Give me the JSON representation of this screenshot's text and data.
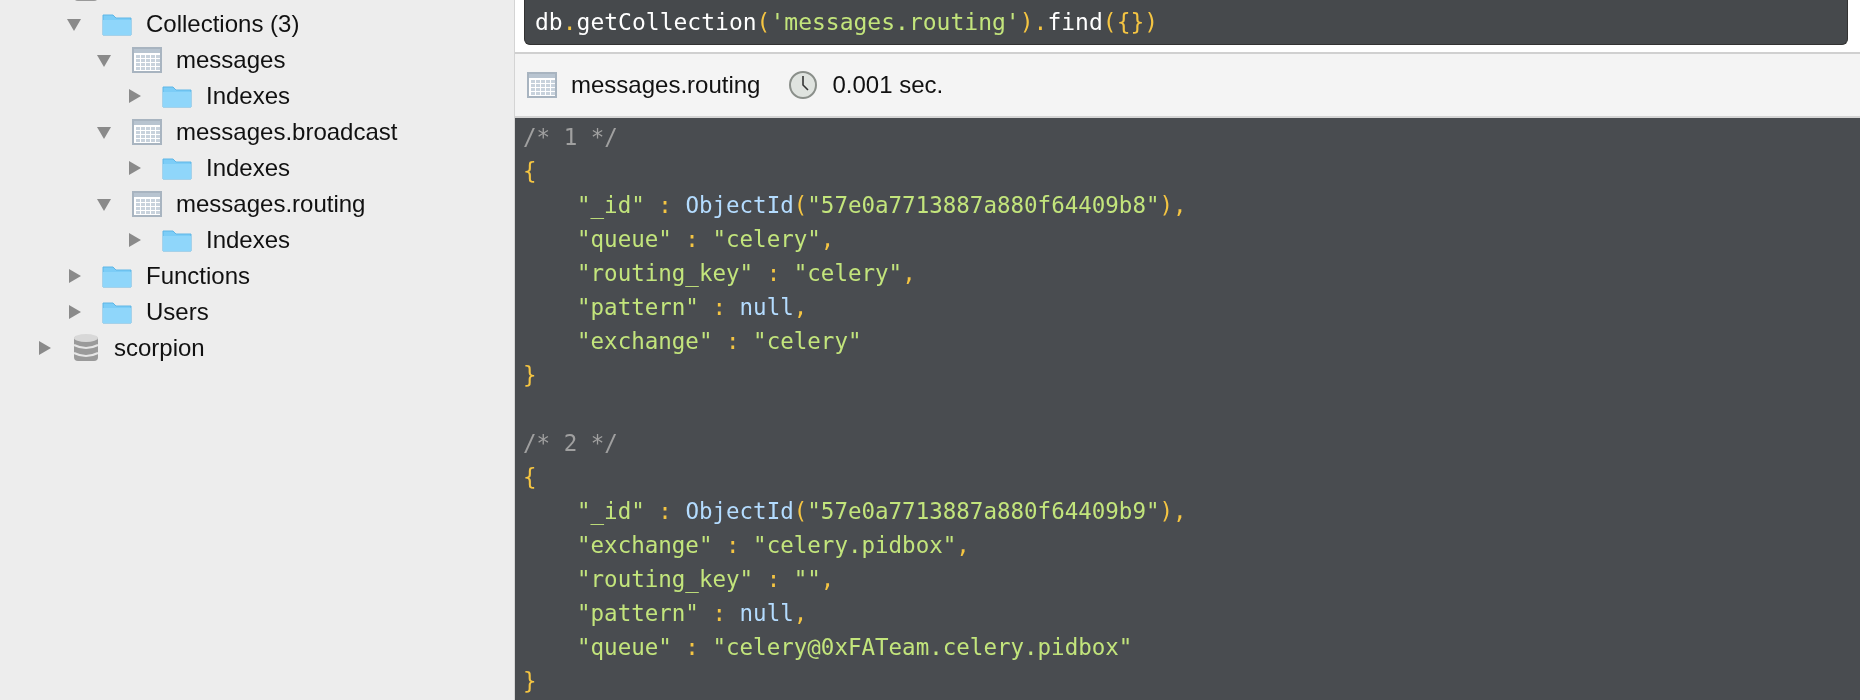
{
  "sidebar": {
    "tree": [
      {
        "kind": "database",
        "children": [
          {
            "kind": "folder",
            "label": "Collections (3)",
            "expanded": true,
            "children": [
              {
                "kind": "table",
                "label": "messages",
                "expanded": true,
                "children": [
                  {
                    "kind": "folder",
                    "label": "Indexes",
                    "expanded": false
                  }
                ]
              },
              {
                "kind": "table",
                "label": "messages.broadcast",
                "expanded": true,
                "children": [
                  {
                    "kind": "folder",
                    "label": "Indexes",
                    "expanded": false
                  }
                ]
              },
              {
                "kind": "table",
                "label": "messages.routing",
                "expanded": true,
                "children": [
                  {
                    "kind": "folder",
                    "label": "Indexes",
                    "expanded": false
                  }
                ]
              }
            ]
          },
          {
            "kind": "folder",
            "label": "Functions",
            "expanded": false
          },
          {
            "kind": "folder",
            "label": "Users",
            "expanded": false
          }
        ]
      },
      {
        "kind": "database",
        "label": "scorpion",
        "expanded": false
      }
    ]
  },
  "query": {
    "calls": [
      {
        "name": "db",
        "after": "."
      },
      {
        "name": "getCollection",
        "open": "(",
        "argument": "'messages.routing'",
        "after": ")."
      },
      {
        "name": "find",
        "after": "({})"
      }
    ]
  },
  "result_header": {
    "collection": "messages.routing",
    "time": "0.001 sec."
  },
  "results": {
    "documents": [
      {
        "comment": "/* 1 */",
        "open": "{",
        "close": "}",
        "fields": [
          [
            {
              "kind": "string",
              "text": "\"_id\""
            },
            {
              "kind": "punct",
              "text": " : "
            },
            {
              "kind": "func",
              "text": "ObjectId"
            },
            {
              "kind": "punct",
              "text": "("
            },
            {
              "kind": "string",
              "text": "\"57e0a7713887a880f64409b8\""
            },
            {
              "kind": "punct",
              "text": "),"
            }
          ],
          [
            {
              "kind": "string",
              "text": "\"queue\""
            },
            {
              "kind": "punct",
              "text": " : "
            },
            {
              "kind": "string",
              "text": "\"celery\""
            },
            {
              "kind": "punct",
              "text": ","
            }
          ],
          [
            {
              "kind": "string",
              "text": "\"routing_key\""
            },
            {
              "kind": "punct",
              "text": " : "
            },
            {
              "kind": "string",
              "text": "\"celery\""
            },
            {
              "kind": "punct",
              "text": ","
            }
          ],
          [
            {
              "kind": "string",
              "text": "\"pattern\""
            },
            {
              "kind": "punct",
              "text": " : "
            },
            {
              "kind": "func",
              "text": "null"
            },
            {
              "kind": "punct",
              "text": ","
            }
          ],
          [
            {
              "kind": "string",
              "text": "\"exchange\""
            },
            {
              "kind": "punct",
              "text": " : "
            },
            {
              "kind": "string",
              "text": "\"celery\""
            }
          ]
        ]
      },
      {
        "comment": "/* 2 */",
        "open": "{",
        "close": "}",
        "fields": [
          [
            {
              "kind": "string",
              "text": "\"_id\""
            },
            {
              "kind": "punct",
              "text": " : "
            },
            {
              "kind": "func",
              "text": "ObjectId"
            },
            {
              "kind": "punct",
              "text": "("
            },
            {
              "kind": "string",
              "text": "\"57e0a7713887a880f64409b9\""
            },
            {
              "kind": "punct",
              "text": "),"
            }
          ],
          [
            {
              "kind": "string",
              "text": "\"exchange\""
            },
            {
              "kind": "punct",
              "text": " : "
            },
            {
              "kind": "string",
              "text": "\"celery.pidbox\""
            },
            {
              "kind": "punct",
              "text": ","
            }
          ],
          [
            {
              "kind": "string",
              "text": "\"routing_key\""
            },
            {
              "kind": "punct",
              "text": " : "
            },
            {
              "kind": "string",
              "text": "\"\""
            },
            {
              "kind": "punct",
              "text": ","
            }
          ],
          [
            {
              "kind": "string",
              "text": "\"pattern\""
            },
            {
              "kind": "punct",
              "text": " : "
            },
            {
              "kind": "func",
              "text": "null"
            },
            {
              "kind": "punct",
              "text": ","
            }
          ],
          [
            {
              "kind": "string",
              "text": "\"queue\""
            },
            {
              "kind": "punct",
              "text": " : "
            },
            {
              "kind": "string",
              "text": "\"celery@0xFATeam.celery.pidbox\""
            }
          ]
        ]
      }
    ]
  }
}
